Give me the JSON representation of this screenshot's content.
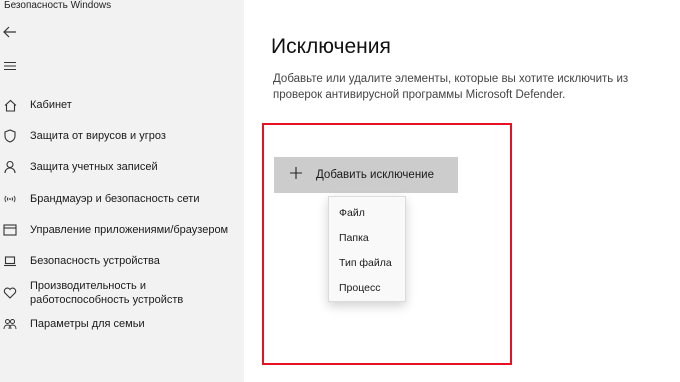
{
  "app_title": "Безопасность Windows",
  "sidebar": {
    "items": [
      {
        "icon": "home-icon",
        "label": "Кабинет"
      },
      {
        "icon": "shield-icon",
        "label": "Защита от вирусов и угроз"
      },
      {
        "icon": "person-icon",
        "label": "Защита учетных записей"
      },
      {
        "icon": "wifi-icon",
        "label": "Брандмауэр и безопасность сети"
      },
      {
        "icon": "app-browser-icon",
        "label": "Управление приложениями/браузером"
      },
      {
        "icon": "laptop-icon",
        "label": "Безопасность устройства"
      },
      {
        "icon": "heart-icon",
        "label_line1": "Производительность и",
        "label_line2": "работоспособность устройств"
      },
      {
        "icon": "family-icon",
        "label": "Параметры для семьи"
      }
    ]
  },
  "main": {
    "title": "Исключения",
    "description_line1": "Добавьте или удалите элементы, которые вы хотите исключить из",
    "description_line2": "проверок антивирусной программы Microsoft Defender.",
    "add_button_label": "Добавить исключение",
    "dropdown_options": [
      "Файл",
      "Папка",
      "Тип файла",
      "Процесс"
    ]
  },
  "colors": {
    "sidebar_bg": "#f2f2f2",
    "highlight_border": "#e81123",
    "button_bg": "#cccccc"
  }
}
